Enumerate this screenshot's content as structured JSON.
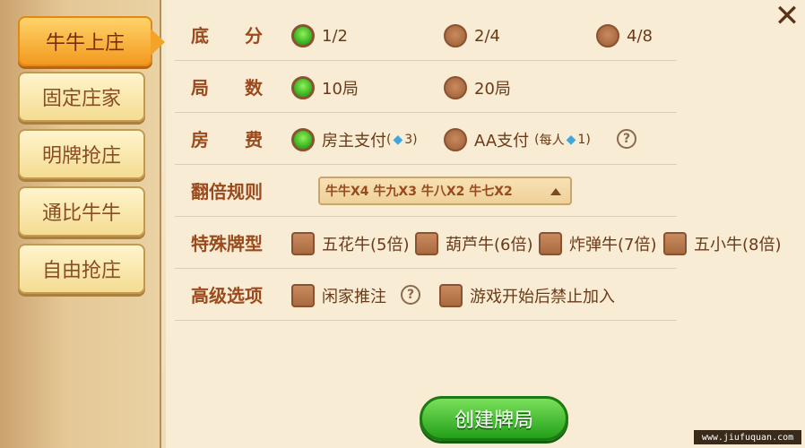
{
  "sidebar": {
    "items": [
      {
        "label": "牛牛上庄",
        "active": true
      },
      {
        "label": "固定庄家",
        "active": false
      },
      {
        "label": "明牌抢庄",
        "active": false
      },
      {
        "label": "通比牛牛",
        "active": false
      },
      {
        "label": "自由抢庄",
        "active": false
      }
    ]
  },
  "rows": {
    "base_score": {
      "label": "底分",
      "options": [
        "1/2",
        "2/4",
        "4/8"
      ],
      "selected": "1/2"
    },
    "rounds": {
      "label": "局数",
      "options": [
        "10局",
        "20局"
      ],
      "selected": "10局"
    },
    "room_fee": {
      "label": "房费",
      "owner_pay": {
        "label": "房主支付",
        "count": "3"
      },
      "aa_pay": {
        "label": "AA支付",
        "per_person": "每人",
        "count": "1"
      },
      "selected": "房主支付"
    },
    "multiplier": {
      "label": "翻倍规则",
      "value": "牛牛X4 牛九X3 牛八X2 牛七X2"
    },
    "special": {
      "label": "特殊牌型",
      "options": [
        "五花牛(5倍)",
        "葫芦牛(6倍)",
        "炸弹牛(7倍)",
        "五小牛(8倍)"
      ]
    },
    "advanced": {
      "label": "高级选项",
      "options": [
        "闲家推注",
        "游戏开始后禁止加入"
      ]
    }
  },
  "create_button": {
    "label": "创建牌局"
  },
  "watermark": "www.jiufuquan.com",
  "colors": {
    "accent_green": "#2fae1b",
    "label_brown": "#9a4a1d",
    "active_orange": "#f29a1e"
  },
  "icons": {
    "close": "close-icon",
    "help": "help-icon",
    "gem": "gem-icon"
  }
}
